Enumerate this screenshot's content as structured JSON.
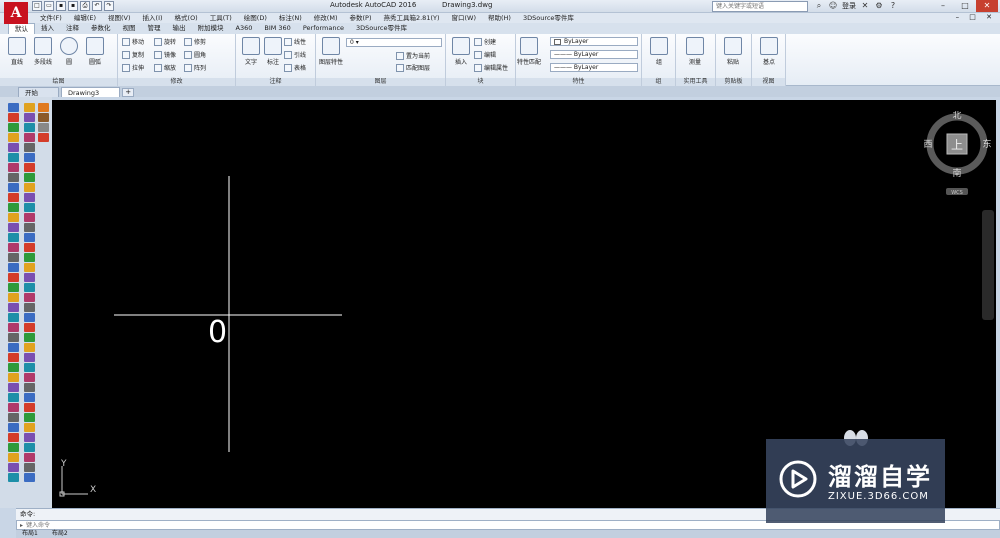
{
  "window": {
    "title": "Autodesk AutoCAD 2016",
    "document": "Drawing3.dwg",
    "search_placeholder": "键入关键字或短语",
    "login_label": "登录"
  },
  "menu": [
    "文件(F)",
    "编辑(E)",
    "视图(V)",
    "插入(I)",
    "格式(O)",
    "工具(T)",
    "绘图(D)",
    "标注(N)",
    "修改(M)",
    "参数(P)",
    "燕秀工具箱2.81(Y)",
    "窗口(W)",
    "帮助(H)",
    "3DSource零件库"
  ],
  "ribbon_tabs": [
    "默认",
    "插入",
    "注释",
    "参数化",
    "视图",
    "管理",
    "输出",
    "附加模块",
    "A360",
    "BIM 360",
    "Performance",
    "3DSource零件库"
  ],
  "ribbon": {
    "draw": {
      "label": "绘图",
      "line": "直线",
      "polyline": "多段线",
      "circle": "圆",
      "arc": "圆弧"
    },
    "modify": {
      "label": "修改",
      "move": "移动",
      "rotate": "旋转",
      "trim": "修剪",
      "copy": "复制",
      "mirror": "镜像",
      "fillet": "圆角",
      "stretch": "拉伸",
      "scale": "缩放",
      "array": "阵列"
    },
    "annotation": {
      "label": "注释",
      "text": "文字",
      "dimension": "标注",
      "linear": "线性",
      "leader": "引线",
      "table": "表格"
    },
    "layers": {
      "label": "图层",
      "layer_props": "图层特性",
      "layer_value": "0",
      "make_current": "置为当前",
      "match_layer": "匹配图层"
    },
    "block": {
      "label": "块",
      "insert": "插入",
      "create": "创建",
      "edit": "编辑",
      "edit_attr": "编辑属性"
    },
    "properties": {
      "label": "特性",
      "match": "特性匹配",
      "color": "ByLayer",
      "linetype": "ByLayer",
      "lineweight": "ByLayer"
    },
    "groups": {
      "label": "组",
      "group": "组"
    },
    "utilities": {
      "label": "实用工具",
      "measure": "测量"
    },
    "clipboard": {
      "label": "剪贴板",
      "paste": "粘贴"
    },
    "view": {
      "label": "视图",
      "base": "基点"
    }
  },
  "doc_tabs": [
    "开始",
    "Drawing3"
  ],
  "canvas": {
    "origin_label": "0",
    "axis_y": "Y",
    "axis_x": "X"
  },
  "viewcube": {
    "north": "北",
    "south": "南",
    "east": "东",
    "west": "西",
    "top": "上",
    "wcs": "WCS"
  },
  "command": {
    "history": "命令:",
    "placeholder": "键入命令",
    "layout_tabs": [
      "布局1",
      "布局2"
    ]
  },
  "watermark": {
    "title": "溜溜自学",
    "subtitle": "ZIXUE.3D66.COM"
  },
  "colors": {
    "canvas": "#000000",
    "accent": "#c8121f",
    "crosshair": "#ffffff"
  }
}
